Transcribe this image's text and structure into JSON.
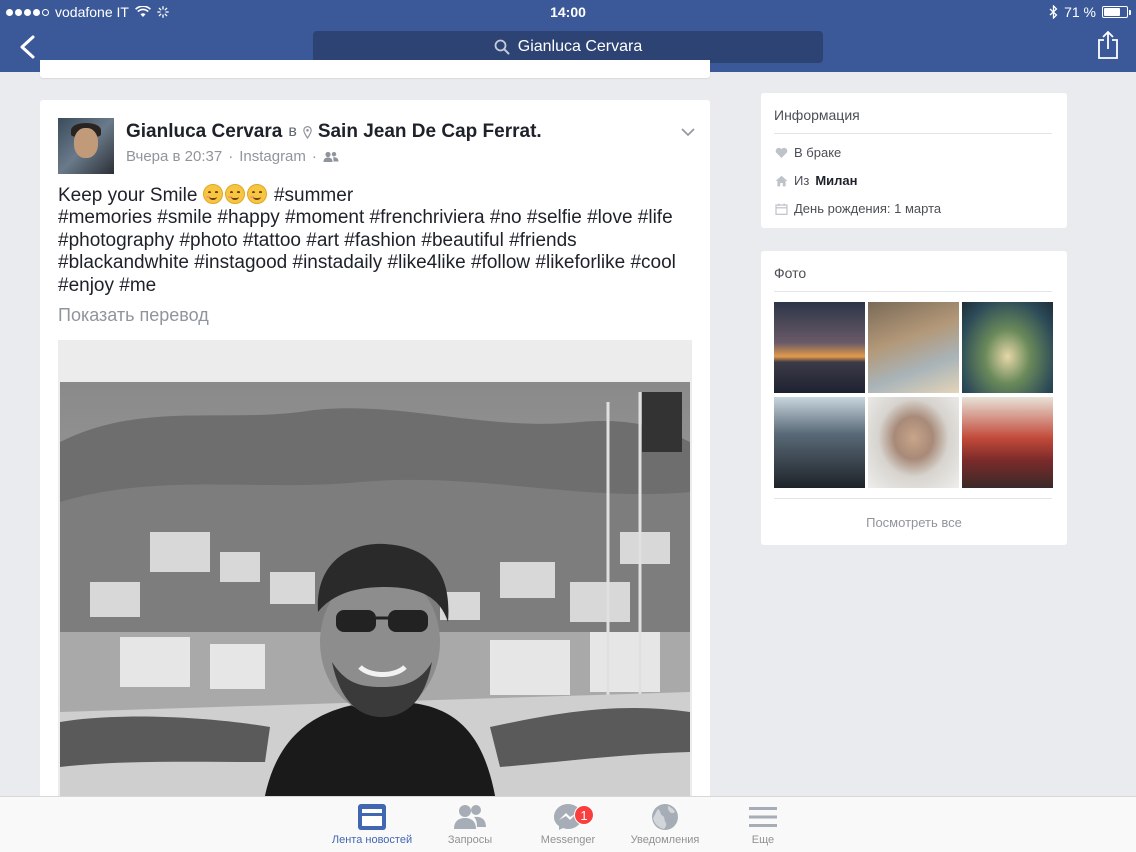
{
  "status_bar": {
    "carrier": "vodafone IT",
    "time": "14:00",
    "battery": "71 %",
    "battery_level": 0.71
  },
  "nav": {
    "search_text": "Gianluca Cervara"
  },
  "post": {
    "author": "Gianluca Cervara",
    "in_word": "в",
    "place": "Sain Jean De Cap Ferrat.",
    "time": "Вчера в 20:37",
    "separator": "·",
    "source": "Instagram",
    "text_intro": "Keep your Smile",
    "hashtag_first": "#summer",
    "hashtags": "#memories #smile #happy #moment #frenchriviera #no #selfie #love #life #photography #photo #tattoo #art #fashion #beautiful #friends #blackandwhite #instagood #instadaily #like4like #follow #likeforlike #cool #enjoy #me",
    "show_translation": "Показать перевод"
  },
  "info": {
    "title": "Информация",
    "relationship": "В браке",
    "from_prefix": "Из",
    "from_city": "Милан",
    "birthday": "День рождения: 1 марта"
  },
  "photos": {
    "title": "Фото",
    "see_all": "Посмотреть все"
  },
  "tabs": [
    {
      "label": "Лента новостей",
      "icon": "news-feed-icon",
      "active": true
    },
    {
      "label": "Запросы",
      "icon": "friend-requests-icon"
    },
    {
      "label": "Messenger",
      "icon": "messenger-icon",
      "badge": "1"
    },
    {
      "label": "Уведомления",
      "icon": "globe-icon"
    },
    {
      "label": "Еще",
      "icon": "menu-icon"
    }
  ],
  "colors": {
    "brand": "#3b5998",
    "search_bg": "#2d4373",
    "active_tab": "#4267b2",
    "badge": "#fa3e3e"
  }
}
